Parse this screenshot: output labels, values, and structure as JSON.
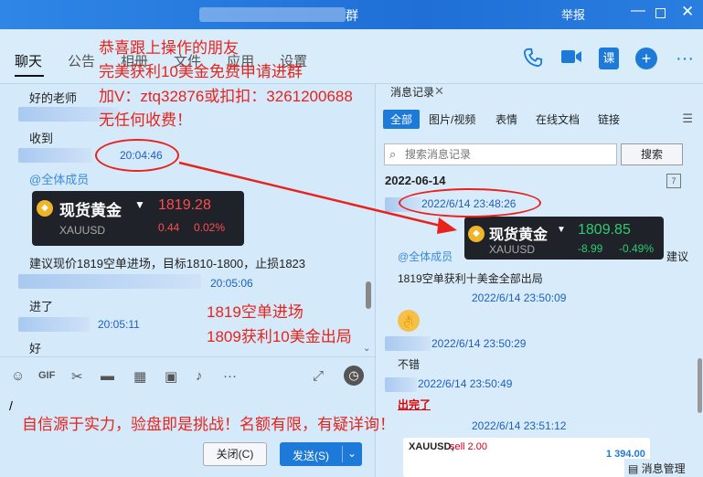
{
  "window": {
    "title_suffix": "群",
    "report": "举报",
    "minimize": "—",
    "close": "✕"
  },
  "tabs": [
    "聊天",
    "公告",
    "相册",
    "文件",
    "应用",
    "设置"
  ],
  "header_icons": {
    "video_label": "",
    "class_label": "课",
    "add_label": "+",
    "more_label": "···"
  },
  "chat": {
    "msg1": "好的老师",
    "msg2": "收到",
    "time1": "20:04:46",
    "mention": "@全体成员",
    "card": {
      "name": "现货黄金",
      "symbol": "XAUUSD",
      "price": "1819.28",
      "change": "0.44",
      "pct": "0.02%"
    },
    "msg3": "建议现价1819空单进场，目标1810-1800，止损1823",
    "time2": "20:05:06",
    "msg4": "进了",
    "time3": "20:05:11",
    "msg5": "好"
  },
  "input": {
    "caret": "/",
    "close_btn": "关闭(C)",
    "send_btn": "发送(S)"
  },
  "history": {
    "tab": "消息记录",
    "filters": [
      "全部",
      "图片/视频",
      "表情",
      "在线文档",
      "链接"
    ],
    "search_placeholder": "搜索消息记录",
    "search_btn": "搜索",
    "date": "2022-06-14",
    "time1": "2022/6/14 23:48:26",
    "card": {
      "name": "现货黄金",
      "symbol": "XAUUSD",
      "price": "1809.85",
      "change": "-8.99",
      "pct": "-0.49%"
    },
    "suggest": "建议",
    "mention": "@全体成员",
    "msg1": "1819空单获利十美金全部出局",
    "time2": "2022/6/14 23:50:09",
    "time3": "2022/6/14 23:50:29",
    "msg2": "不错",
    "time4": "2022/6/14 23:50:49",
    "msg3": "出完了",
    "time5": "2022/6/14 23:51:12",
    "trade": {
      "symbol": "XAUUSD,",
      "side": "sell 2.00",
      "value": "1 394.00"
    },
    "msg_mgr": "消息管理"
  },
  "overlay": {
    "line1": "恭喜跟上操作的朋友",
    "line2": "完美获利10美金免费申请进群",
    "line3": "加V：ztq32876或扣扣：3261200688",
    "line4": "无任何收费！",
    "entry1": "1819空单进场",
    "entry2": "1809获利10美金出局",
    "bottom": "自信源于实力，验盘即是挑战！名额有限，有疑详询！"
  },
  "colors": {
    "accent": "#1d7ad8",
    "annotation": "#e8231c",
    "down": "#ff4d4f",
    "up": "#2ecc71"
  }
}
